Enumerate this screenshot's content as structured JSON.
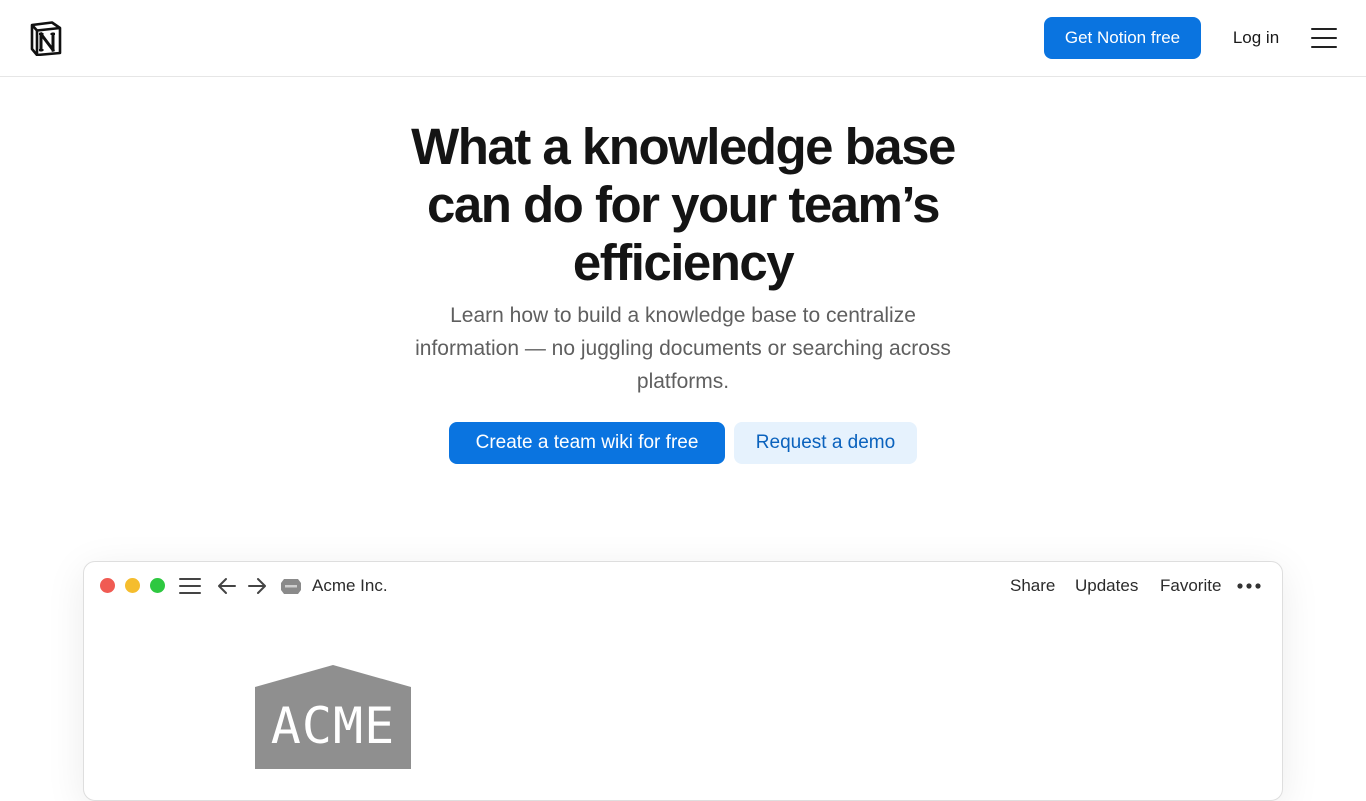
{
  "nav": {
    "logo_icon": "notion-logo-icon",
    "get_free_label": "Get Notion free",
    "login_label": "Log in",
    "menu_icon": "hamburger-menu-icon"
  },
  "hero": {
    "title": "What a knowledge base can do for your team’s efficiency",
    "subtitle": "Learn how to build a knowledge base to centralize information — no juggling documents or searching across platforms.",
    "cta_primary": "Create a team wiki for free",
    "cta_secondary": "Request a demo"
  },
  "app_preview": {
    "workspace_name": "Acme Inc.",
    "actions": {
      "share": "Share",
      "updates": "Updates",
      "favorite": "Favorite"
    },
    "logo_text": "ACME",
    "traffic_colors": [
      "#f05b53",
      "#f5bd2e",
      "#2ec840"
    ]
  },
  "colors": {
    "accent": "#0a74e0",
    "secondary_bg": "#e6f2fd",
    "secondary_text": "#0a62bd"
  }
}
